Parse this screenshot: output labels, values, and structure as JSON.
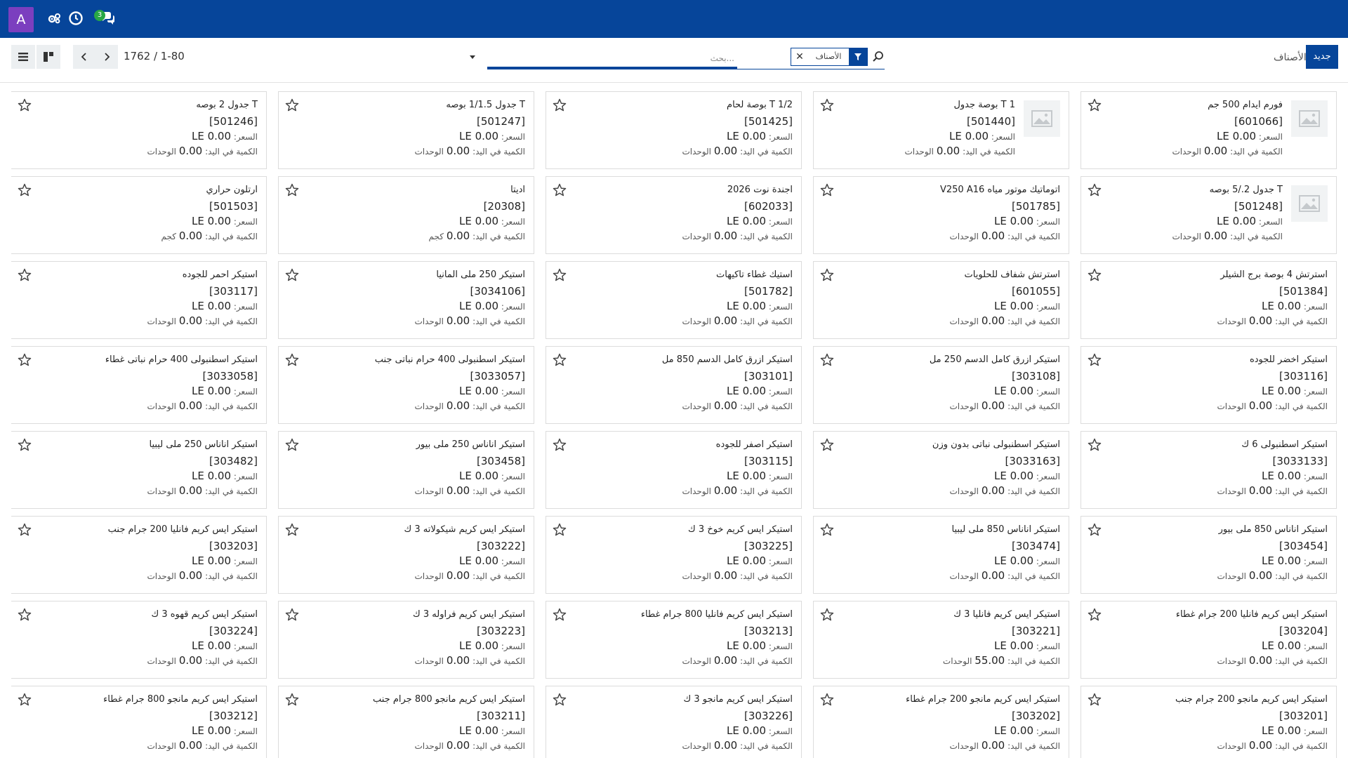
{
  "navbar": {
    "avatar_letter": "A",
    "message_count": "3",
    "icons": [
      "settings-users-icon",
      "clock-icon",
      "chat-icon"
    ],
    "background": "#06459a",
    "avatar_color": "#7b3fbf"
  },
  "control": {
    "pager": "1762 / 1-80",
    "search_placeholder": "بحث...",
    "facet_label": "الأصناف",
    "breadcrumb": "الأصناف",
    "new_label": "جديد"
  },
  "labels": {
    "price_prefix": "السعر:",
    "qty_prefix": "الكمية في اليد:"
  },
  "products": [
    {
      "title": "فورم ايدام 500 جم",
      "code": "[601066]",
      "price": "0.00 LE",
      "qty": "0.00",
      "unit": "الوحدات",
      "has_image": true
    },
    {
      "title": "T 1 بوصة جدول",
      "code": "[501440]",
      "price": "0.00 LE",
      "qty": "0.00",
      "unit": "الوحدات",
      "has_image": true
    },
    {
      "title": "T 1/2 بوصة لحام",
      "code": "[501425]",
      "price": "0.00 LE",
      "qty": "0.00",
      "unit": "الوحدات",
      "has_image": false
    },
    {
      "title": "T جدول 1/1.5 بوصه",
      "code": "[501247]",
      "price": "0.00 LE",
      "qty": "0.00",
      "unit": "الوحدات",
      "has_image": false
    },
    {
      "title": "T جدول 2 بوصه",
      "code": "[501246]",
      "price": "0.00 LE",
      "qty": "0.00",
      "unit": "الوحدات",
      "has_image": false
    },
    {
      "title": "T جدول 2./5 بوصه",
      "code": "[501248]",
      "price": "0.00 LE",
      "qty": "0.00",
      "unit": "الوحدات",
      "has_image": true
    },
    {
      "title": "اتوماتيك موتور مياه V250 A16",
      "code": "[501785]",
      "price": "0.00 LE",
      "qty": "0.00",
      "unit": "الوحدات",
      "has_image": false
    },
    {
      "title": "اجندة نوت 2026",
      "code": "[602033]",
      "price": "0.00 LE",
      "qty": "0.00",
      "unit": "الوحدات",
      "has_image": false
    },
    {
      "title": "اديتا",
      "code": "[20308]",
      "price": "0.00 LE",
      "qty": "0.00",
      "unit": "كجم",
      "has_image": false
    },
    {
      "title": "ارتلون حراري",
      "code": "[501503]",
      "price": "0.00 LE",
      "qty": "0.00",
      "unit": "كجم",
      "has_image": false
    },
    {
      "title": "استرتش 4 بوصة برج الشيلر",
      "code": "[501384]",
      "price": "0.00 LE",
      "qty": "0.00",
      "unit": "الوحدات",
      "has_image": false
    },
    {
      "title": "استرتش شفاف للحلويات",
      "code": "[601055]",
      "price": "0.00 LE",
      "qty": "0.00",
      "unit": "الوحدات",
      "has_image": false
    },
    {
      "title": "استيك غطاء تاكيهات",
      "code": "[501782]",
      "price": "0.00 LE",
      "qty": "0.00",
      "unit": "الوحدات",
      "has_image": false
    },
    {
      "title": "استيكر 250 ملى المانيا",
      "code": "[3034106]",
      "price": "0.00 LE",
      "qty": "0.00",
      "unit": "الوحدات",
      "has_image": false
    },
    {
      "title": "استيكر احمر للجوده",
      "code": "[303117]",
      "price": "0.00 LE",
      "qty": "0.00",
      "unit": "الوحدات",
      "has_image": false
    },
    {
      "title": "استيكر اخضر للجوده",
      "code": "[303116]",
      "price": "0.00 LE",
      "qty": "0.00",
      "unit": "الوحدات",
      "has_image": false
    },
    {
      "title": "استيكر ازرق كامل الدسم 250 مل",
      "code": "[303108]",
      "price": "0.00 LE",
      "qty": "0.00",
      "unit": "الوحدات",
      "has_image": false
    },
    {
      "title": "استيكر ازرق كامل الدسم 850 مل",
      "code": "[303101]",
      "price": "0.00 LE",
      "qty": "0.00",
      "unit": "الوحدات",
      "has_image": false
    },
    {
      "title": "استيكر اسطنبولى 400 حرام نباتى جنب",
      "code": "[3033057]",
      "price": "0.00 LE",
      "qty": "0.00",
      "unit": "الوحدات",
      "has_image": false
    },
    {
      "title": "استيكر اسطنبولى 400 حرام نباتى غطاء",
      "code": "[3033058]",
      "price": "0.00 LE",
      "qty": "0.00",
      "unit": "الوحدات",
      "has_image": false
    },
    {
      "title": "استيكر اسطنبولى 6 ك",
      "code": "[3033133]",
      "price": "0.00 LE",
      "qty": "0.00",
      "unit": "الوحدات",
      "has_image": false
    },
    {
      "title": "استيكر اسطنبولى نباتى بدون وزن",
      "code": "[3033163]",
      "price": "0.00 LE",
      "qty": "0.00",
      "unit": "الوحدات",
      "has_image": false
    },
    {
      "title": "استيكر اصفر للجوده",
      "code": "[303115]",
      "price": "0.00 LE",
      "qty": "0.00",
      "unit": "الوحدات",
      "has_image": false
    },
    {
      "title": "استيكر اناناس 250 ملى بيور",
      "code": "[303458]",
      "price": "0.00 LE",
      "qty": "0.00",
      "unit": "الوحدات",
      "has_image": false
    },
    {
      "title": "استيكر اناناس 250 ملى ليبيا",
      "code": "[303482]",
      "price": "0.00 LE",
      "qty": "0.00",
      "unit": "الوحدات",
      "has_image": false
    },
    {
      "title": "استيكر اناناس 850 ملى بيور",
      "code": "[303454]",
      "price": "0.00 LE",
      "qty": "0.00",
      "unit": "الوحدات",
      "has_image": false
    },
    {
      "title": "استيكر اناناس 850 ملى ليبيا",
      "code": "[303474]",
      "price": "0.00 LE",
      "qty": "0.00",
      "unit": "الوحدات",
      "has_image": false
    },
    {
      "title": "استيكر ايس كريم خوخ 3 ك",
      "code": "[303225]",
      "price": "0.00 LE",
      "qty": "0.00",
      "unit": "الوحدات",
      "has_image": false
    },
    {
      "title": "استيكر ايس كريم شيكولاته 3 ك",
      "code": "[303222]",
      "price": "0.00 LE",
      "qty": "0.00",
      "unit": "الوحدات",
      "has_image": false
    },
    {
      "title": "استيكر ايس كريم فانليا 200 جرام جنب",
      "code": "[303203]",
      "price": "0.00 LE",
      "qty": "0.00",
      "unit": "الوحدات",
      "has_image": false
    },
    {
      "title": "استيكر ايس كريم فانليا 200 جرام غطاء",
      "code": "[303204]",
      "price": "0.00 LE",
      "qty": "0.00",
      "unit": "الوحدات",
      "has_image": false
    },
    {
      "title": "استيكر ايس كريم فانليا 3 ك",
      "code": "[303221]",
      "price": "0.00 LE",
      "qty": "55.00",
      "unit": "الوحدات",
      "has_image": false
    },
    {
      "title": "استيكر ايس كريم فانليا 800 جرام غطاء",
      "code": "[303213]",
      "price": "0.00 LE",
      "qty": "0.00",
      "unit": "الوحدات",
      "has_image": false
    },
    {
      "title": "استيكر ايس كريم فراوله 3 ك",
      "code": "[303223]",
      "price": "0.00 LE",
      "qty": "0.00",
      "unit": "الوحدات",
      "has_image": false
    },
    {
      "title": "استيكر ايس كريم قهوه 3 ك",
      "code": "[303224]",
      "price": "0.00 LE",
      "qty": "0.00",
      "unit": "الوحدات",
      "has_image": false
    },
    {
      "title": "استيكر ايس كريم مانجو 200 جرام جنب",
      "code": "[303201]",
      "price": "0.00 LE",
      "qty": "0.00",
      "unit": "الوحدات",
      "has_image": false
    },
    {
      "title": "استيكر ايس كريم مانجو 200 جرام غطاء",
      "code": "[303202]",
      "price": "0.00 LE",
      "qty": "0.00",
      "unit": "الوحدات",
      "has_image": false
    },
    {
      "title": "استيكر ايس كريم مانجو 3 ك",
      "code": "[303226]",
      "price": "0.00 LE",
      "qty": "0.00",
      "unit": "الوحدات",
      "has_image": false
    },
    {
      "title": "استيكر ايس كريم مانجو 800 جرام جنب",
      "code": "[303211]",
      "price": "0.00 LE",
      "qty": "0.00",
      "unit": "الوحدات",
      "has_image": false
    },
    {
      "title": "استيكر ايس كريم مانجو 800 جرام غطاء",
      "code": "[303212]",
      "price": "0.00 LE",
      "qty": "0.00",
      "unit": "الوحدات",
      "has_image": false
    }
  ]
}
